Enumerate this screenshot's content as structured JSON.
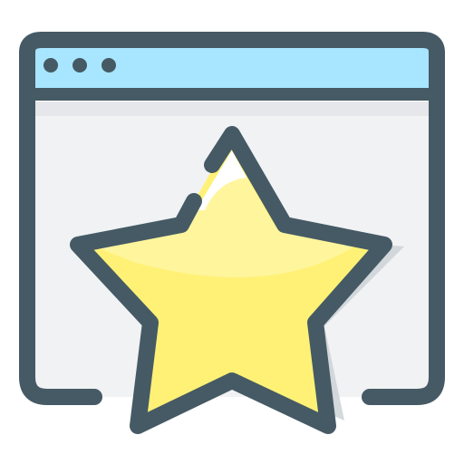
{
  "icon": {
    "name": "browser-favorite-star-icon",
    "window": {
      "dots_count": 3,
      "colors": {
        "outline": "#455A64",
        "titlebar": "#A8E5FF",
        "body_fill": "#F1F2F4",
        "body_shading": "#E6E7EA"
      }
    },
    "star": {
      "colors": {
        "outline": "#455A64",
        "fill": "#FFF176",
        "highlight": "#FFF59D",
        "shine": "#FFFFFF",
        "shadow": "#CCD2D6"
      }
    }
  }
}
